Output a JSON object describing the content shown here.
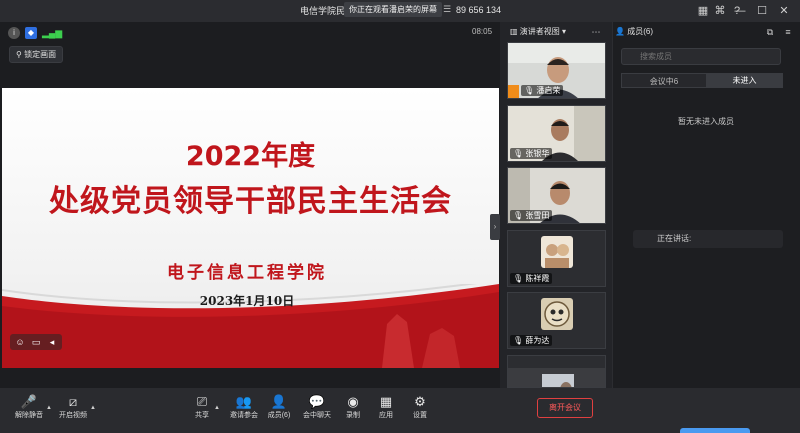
{
  "window": {
    "title": "电信学院民",
    "banner": "你正在观看潘启荣的屏幕",
    "meeting_id": "89 656 134",
    "timer": "08:05",
    "buttons": {
      "minimize": "—",
      "maximize": "☐",
      "close": "✕"
    }
  },
  "stage": {
    "lock_button": "锁定画面"
  },
  "slide": {
    "year_title": "2022年度",
    "main_title": "处级党员领导干部民主生活会",
    "organization": "电子信息工程学院",
    "date": "2023年1月10日",
    "colors": {
      "accent": "#c0161c"
    }
  },
  "video_column": {
    "view_label": "演讲者视图",
    "tiles": [
      {
        "name": "潘启荣",
        "speaking": true
      },
      {
        "name": "张银华",
        "speaking": false
      },
      {
        "name": "张雪田",
        "speaking": false
      },
      {
        "name": "陈祥霞",
        "speaking": false
      },
      {
        "name": "薛为达",
        "speaking": false
      },
      {
        "name": "",
        "speaking": false
      }
    ]
  },
  "member_panel": {
    "title": "成员(6)",
    "search_placeholder": "搜索成员",
    "tabs": [
      {
        "label": "会议中6",
        "active": false
      },
      {
        "label": "未进入",
        "active": true
      }
    ],
    "empty_text": "暂无未进入成员",
    "speaking_label": "正在讲话:"
  },
  "toolbar": {
    "unmute": "解除静音",
    "start_video": "开启视频",
    "share": "共享",
    "invite": "邀请参会",
    "members": "成员(6)",
    "chat": "会中聊天",
    "record": "录制",
    "apps": "应用",
    "settings": "设置",
    "leave": "离开会议"
  }
}
